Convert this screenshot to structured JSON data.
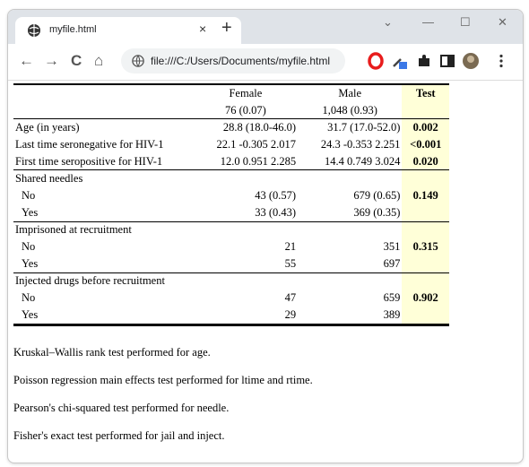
{
  "tab": {
    "title": "myfile.html",
    "close_icon": "×",
    "new_tab_icon": "+"
  },
  "window_controls": {
    "chevron": "⌄",
    "minimize": "—",
    "maximize": "☐",
    "close": "✕"
  },
  "nav": {
    "back": "←",
    "forward": "→",
    "reload": "C",
    "home": "⌂"
  },
  "address": {
    "url": "file:///C:/Users/Documents/myfile.html"
  },
  "table": {
    "headers": {
      "female": "Female",
      "male": "Male",
      "test": "Test",
      "female_n": "76 (0.07)",
      "male_n": "1,048 (0.93)"
    },
    "rows": [
      {
        "label": "Age (in years)",
        "female": "28.8 (18.0-46.0)",
        "male": "31.7 (17.0-52.0)",
        "test": "0.002"
      },
      {
        "label": "Last time seronegative for HIV-1",
        "female": "22.1 -0.305 2.017",
        "male": "24.3 -0.353 2.251",
        "test": "<0.001"
      },
      {
        "label": "First time seropositive for HIV-1",
        "female": "12.0 0.951 2.285",
        "male": "14.4 0.749 3.024",
        "test": "0.020"
      },
      {
        "label": "Shared needles",
        "female": "",
        "male": "",
        "test": ""
      },
      {
        "label": "No",
        "female": "43 (0.57)",
        "male": "679 (0.65)",
        "test": "0.149"
      },
      {
        "label": "Yes",
        "female": "33 (0.43)",
        "male": "369 (0.35)",
        "test": ""
      },
      {
        "label": "Imprisoned at recruitment",
        "female": "",
        "male": "",
        "test": ""
      },
      {
        "label": "No",
        "female": "21",
        "male": "351",
        "test": "0.315"
      },
      {
        "label": "Yes",
        "female": "55",
        "male": "697",
        "test": ""
      },
      {
        "label": "Injected drugs before recruitment",
        "female": "",
        "male": "",
        "test": ""
      },
      {
        "label": "No",
        "female": "47",
        "male": "659",
        "test": "0.902"
      },
      {
        "label": "Yes",
        "female": "29",
        "male": "389",
        "test": ""
      }
    ]
  },
  "notes": [
    "Kruskal–Wallis rank test performed for age.",
    "Poisson regression main effects test performed for ltime and rtime.",
    "Pearson's chi-squared test performed for needle.",
    "Fisher's exact test performed for jail and inject."
  ]
}
